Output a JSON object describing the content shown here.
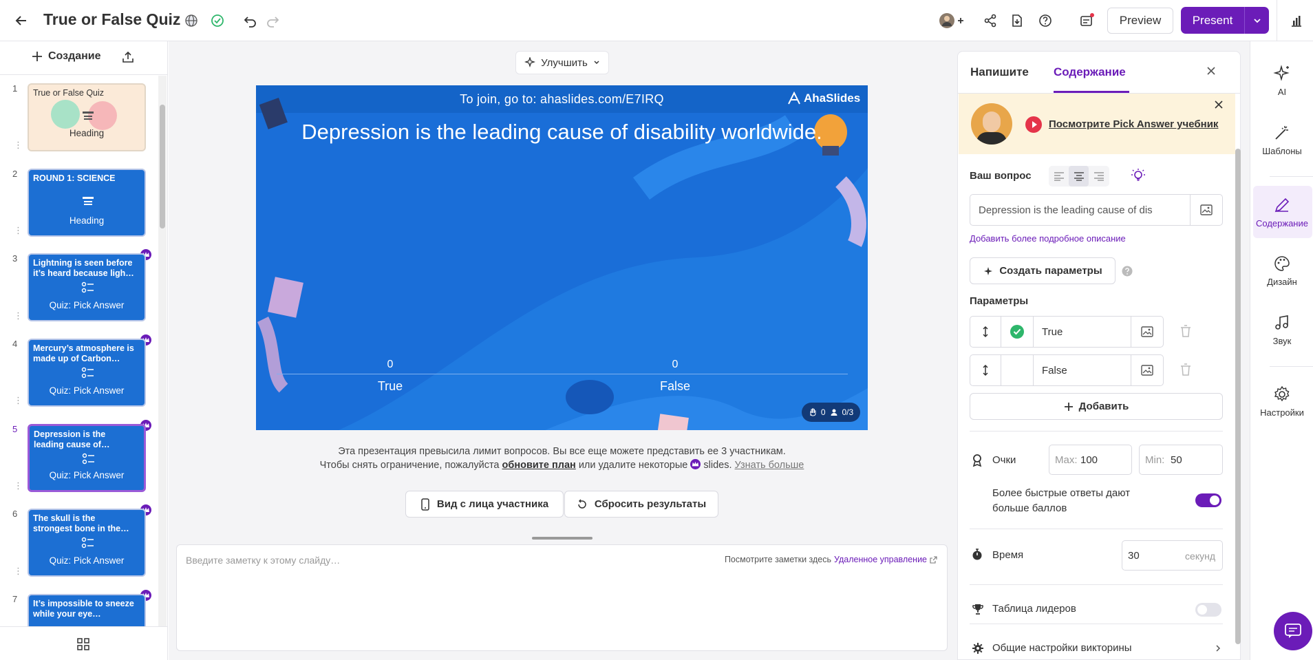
{
  "header": {
    "title": "True or False Quiz",
    "preview_label": "Preview",
    "present_label": "Present"
  },
  "left": {
    "create_label": "Создание",
    "slides": [
      {
        "num": "1",
        "title": "True or False Quiz",
        "type": "Heading"
      },
      {
        "num": "2",
        "title": "ROUND 1: SCIENCE",
        "type": "Heading"
      },
      {
        "num": "3",
        "title": "Lightning is seen before it’s heard because ligh…",
        "type": "Quiz: Pick Answer"
      },
      {
        "num": "4",
        "title": "Mercury’s atmosphere is made up of Carbon…",
        "type": "Quiz: Pick Answer"
      },
      {
        "num": "5",
        "title": "Depression is the leading cause of…",
        "type": "Quiz: Pick Answer"
      },
      {
        "num": "6",
        "title": "The skull is the strongest bone in the…",
        "type": "Quiz: Pick Answer"
      },
      {
        "num": "7",
        "title": "It’s impossible to sneeze while your eye…",
        "type": ""
      }
    ]
  },
  "center": {
    "improve_label": "Улучшить",
    "join_text": "To join, go to: ahaslides.com/E7IRQ",
    "brand": "AhaSlides",
    "question": "Depression is the leading cause of disability worldwide.",
    "options": [
      {
        "label": "True",
        "count": "0"
      },
      {
        "label": "False",
        "count": "0"
      }
    ],
    "reactions": "0",
    "participants": "0/3",
    "notice_line1": "Эта презентация превысила лимит вопросов. Вы все еще можете представить ее 3 участникам.",
    "notice_line2_a": "Чтобы снять ограничение, пожалуйста",
    "notice_upgrade": "обновите план",
    "notice_line2_b": "или удалите некоторые",
    "notice_slides": "slides.",
    "notice_learn": "Узнать больше",
    "participant_view_label": "Вид с лица участника",
    "reset_label": "Сбросить результаты",
    "notes_placeholder": "Введите заметку к этому слайду…",
    "notes_see": "Посмотрите заметки здесь",
    "notes_remote": "Удаленное управление"
  },
  "panel": {
    "tab_write": "Напишите",
    "tab_content": "Содержание",
    "tutorial": "Посмотрите Pick Answer учебник",
    "question_label": "Ваш вопрос",
    "question_value": "Depression is the leading cause of dis",
    "add_desc": "Добавить более подробное описание",
    "gen_params": "Создать параметры",
    "params_label": "Параметры",
    "option1": "True",
    "option2": "False",
    "add_label": "Добавить",
    "points_label": "Очки",
    "max_label": "Max:",
    "max_value": "100",
    "min_label": "Min:",
    "min_value": "50",
    "faster_label": "Более быстрые ответы дают больше баллов",
    "faster_on": true,
    "time_label": "Время",
    "time_value": "30",
    "time_unit": "секунд",
    "leaderboard_label": "Таблица лидеров",
    "leaderboard_on": false,
    "general_label": "Общие настройки викторины"
  },
  "rail": {
    "ai": "AI",
    "templates": "Шаблоны",
    "content": "Содержание",
    "design": "Дизайн",
    "audio": "Звук",
    "settings": "Настройки"
  },
  "colors": {
    "accent": "#6b1cb8",
    "slide_blue": "#1a6ed8",
    "correct": "#2eb66b"
  }
}
